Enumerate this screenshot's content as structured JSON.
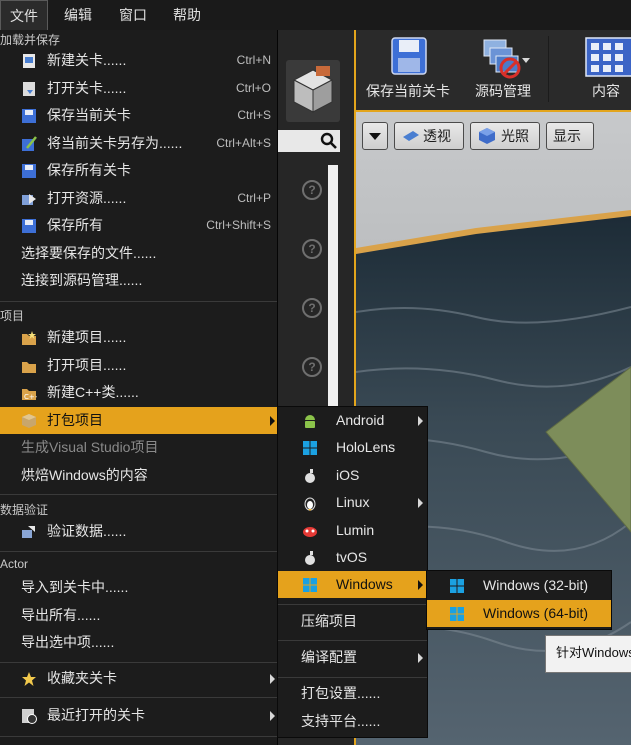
{
  "menubar": {
    "items": [
      "文件",
      "编辑",
      "窗口",
      "帮助"
    ]
  },
  "toolbar": {
    "save_level": "保存当前关卡",
    "source_control": "源码管理",
    "content": "内容"
  },
  "viewport": {
    "perspective": "透视",
    "lit": "光照",
    "show": "显示"
  },
  "file_menu": {
    "section_load_save": "加载并保存",
    "new_level": "新建关卡......",
    "new_level_sc": "Ctrl+N",
    "open_level": "打开关卡......",
    "open_level_sc": "Ctrl+O",
    "save_current": "保存当前关卡",
    "save_current_sc": "Ctrl+S",
    "save_as": "将当前关卡另存为......",
    "save_as_sc": "Ctrl+Alt+S",
    "save_all_levels": "保存所有关卡",
    "open_asset": "打开资源......",
    "open_asset_sc": "Ctrl+P",
    "save_all": "保存所有",
    "save_all_sc": "Ctrl+Shift+S",
    "choose_files": "选择要保存的文件......",
    "connect_source": "连接到源码管理......",
    "section_project": "项目",
    "new_project": "新建项目......",
    "open_project": "打开项目......",
    "new_cpp": "新建C++类......",
    "package_project": "打包项目",
    "gen_vs": "生成Visual Studio项目",
    "cook_windows": "烘焙Windows的内容",
    "section_validate": "数据验证",
    "validate_data": "验证数据......",
    "section_actor": "Actor",
    "import_into": "导入到关卡中......",
    "export_all": "导出所有......",
    "export_selected": "导出选中项......",
    "favorite_levels": "收藏夹关卡",
    "recent_levels": "最近打开的关卡"
  },
  "platform_menu": {
    "items": [
      "Android",
      "HoloLens",
      "iOS",
      "Linux",
      "Lumin",
      "tvOS",
      "Windows"
    ],
    "compress": "压缩项目",
    "build_config": "编译配置",
    "package_settings": "打包设置......",
    "supported_platforms": "支持平台......"
  },
  "windows_menu": {
    "win32": "Windows (32-bit)",
    "win64": "Windows (64-bit)"
  },
  "tooltip": {
    "text": "针对Windows"
  },
  "colors": {
    "highlight": "#e5a21c",
    "menu_bg": "#1c1c1c",
    "android_green": "#8bc34a",
    "windows_blue": "#1ba1e2",
    "lumin_red": "#e53935"
  }
}
